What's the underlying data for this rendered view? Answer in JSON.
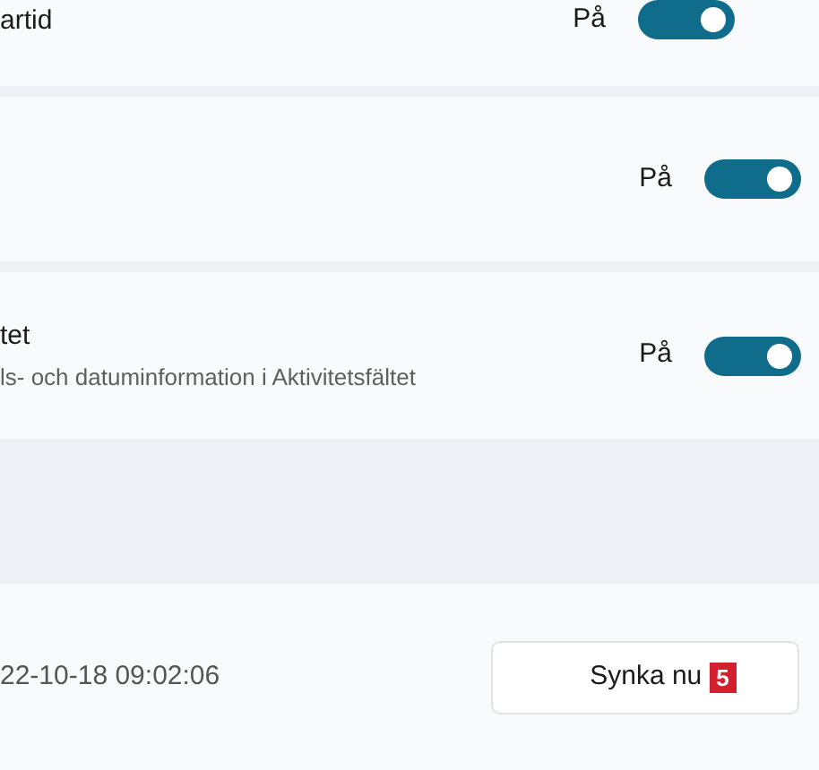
{
  "settings": [
    {
      "title": "artid",
      "state_label": "På",
      "on": true
    },
    {
      "state_label": "På",
      "on": true
    },
    {
      "title": "tet",
      "description": "ls- och datuminformation i Aktivitetsfältet",
      "state_label": "På",
      "on": true
    }
  ],
  "sync": {
    "last_synced": "22-10-18 09:02:06",
    "button": "Synka nu",
    "badge": "5"
  }
}
